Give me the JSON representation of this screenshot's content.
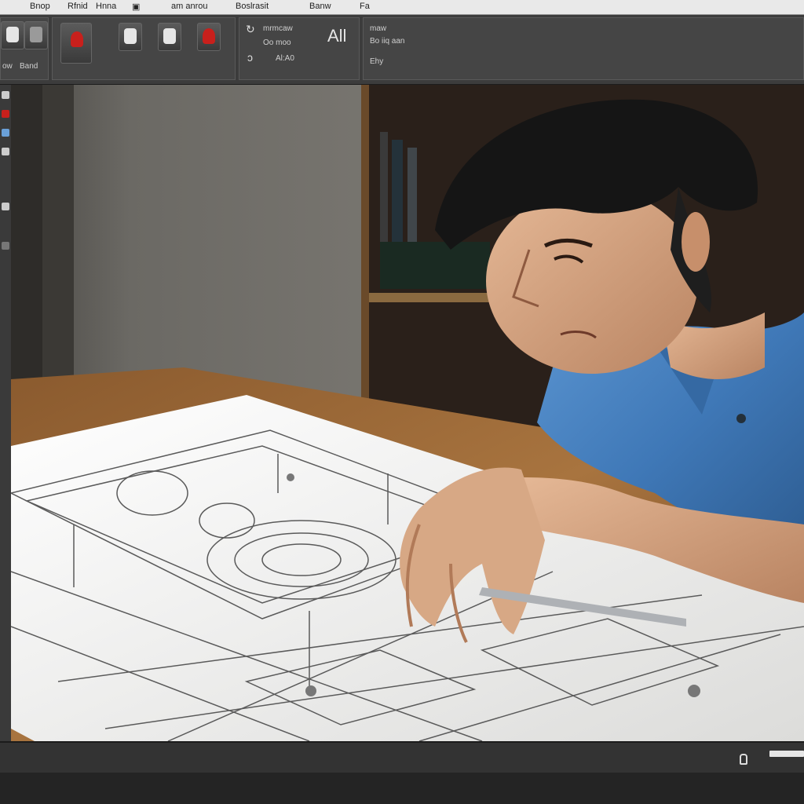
{
  "menubar": {
    "items": [
      "Bnop",
      "Rfnid",
      "Hnna",
      "▣",
      "am anrou",
      "Boslrasit",
      "Banw",
      "Fa"
    ]
  },
  "ribbon": {
    "panel1_labels": [
      "ow",
      "Band"
    ],
    "panel3": {
      "row1": "mrmcaw",
      "row2": "Oo moo",
      "row3": "Al:A0",
      "glyph": "All"
    },
    "panel4": {
      "row1": "maw",
      "row2": "Bo iiq aan",
      "row3": "Ehy"
    }
  },
  "colors": {
    "app_chrome": "#3c3c3c",
    "accent_red": "#c8201c",
    "shirt_blue": "#3f78b7",
    "paper": "#f2f2f0"
  },
  "icons": [
    "user-icon",
    "document-icon",
    "red-tool-icon",
    "camera-icon",
    "figure-icon",
    "red-record-icon",
    "refresh-icon",
    "paint-icon"
  ]
}
